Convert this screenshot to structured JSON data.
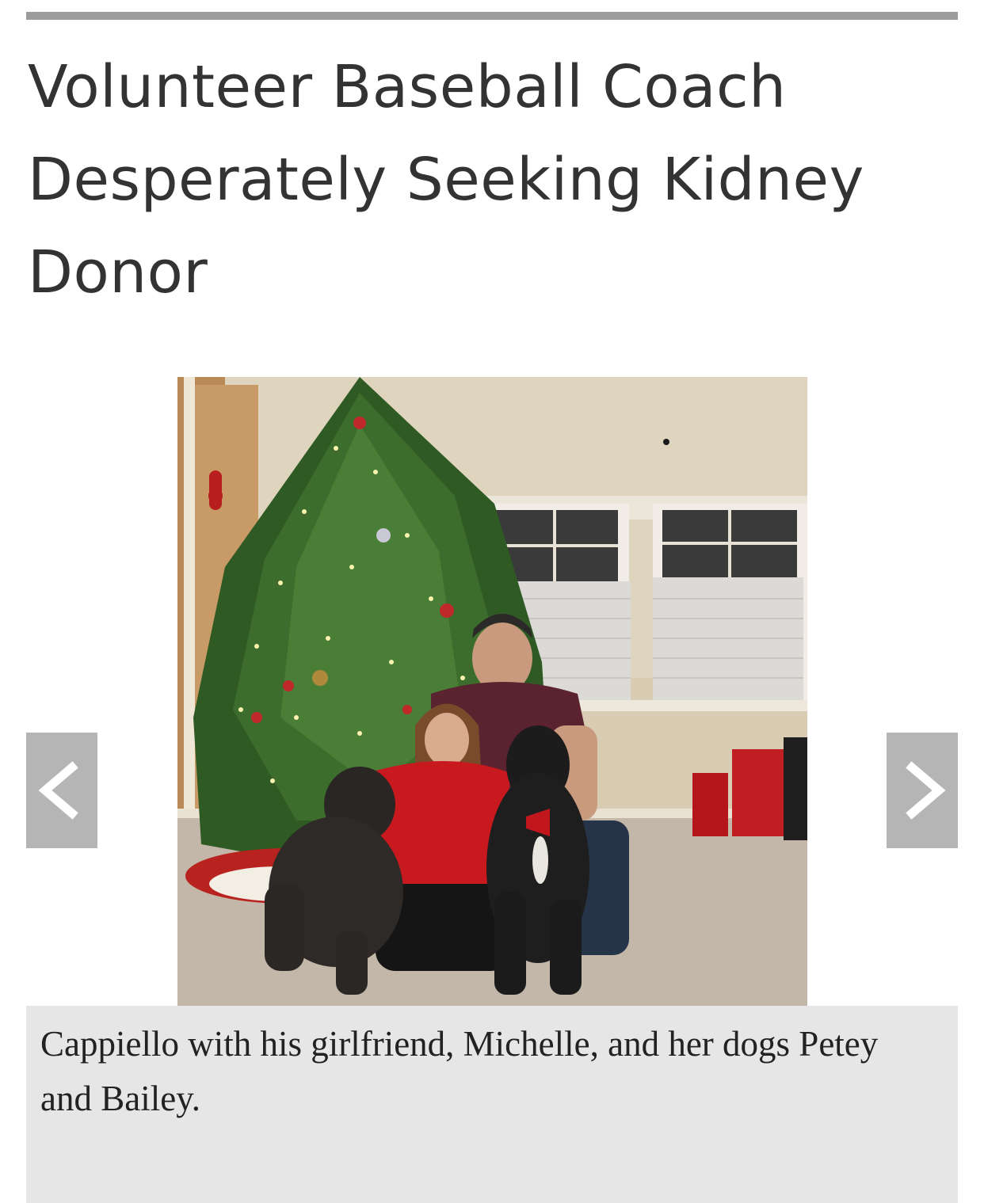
{
  "article": {
    "headline": "Volunteer Baseball Coach Desperately Seeking Kidney Donor"
  },
  "slideshow": {
    "caption": "Cappiello with his girlfriend, Michelle, and her dogs Petey and Bailey.",
    "prev_icon": "chevron-left-icon",
    "next_icon": "chevron-right-icon"
  },
  "colors": {
    "rule": "#9b9b9b",
    "headline": "#333333",
    "nav_button": "#b5b5b5",
    "caption_bg": "#e6e6e6"
  }
}
